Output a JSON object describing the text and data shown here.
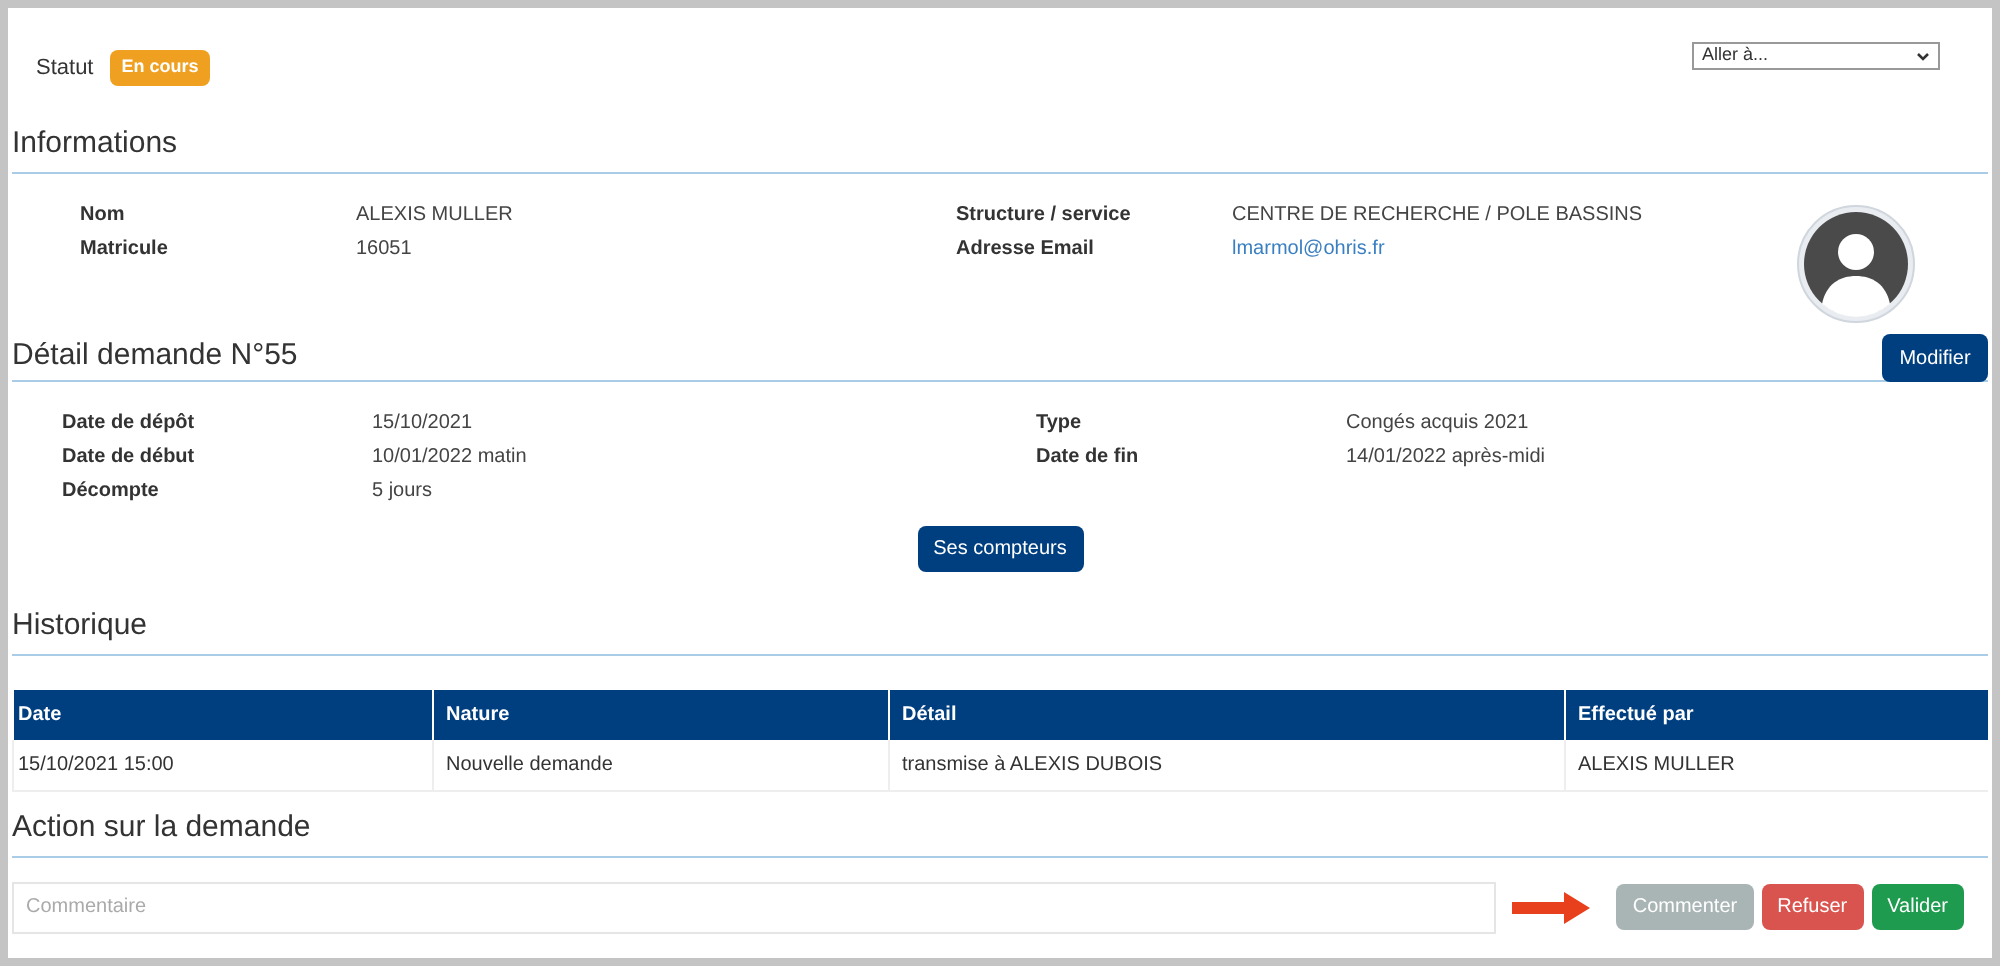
{
  "status": {
    "label": "Statut",
    "badge": "En cours"
  },
  "goto": {
    "value": "Aller à..."
  },
  "informations": {
    "title": "Informations",
    "left": [
      {
        "label": "Nom",
        "value": "ALEXIS MULLER"
      },
      {
        "label": "Matricule",
        "value": "16051"
      }
    ],
    "right": [
      {
        "label": "Structure / service",
        "value": "CENTRE DE RECHERCHE / POLE BASSINS"
      },
      {
        "label": "Adresse Email",
        "value": "lmarmol@ohris.fr",
        "kind": "link"
      }
    ]
  },
  "detail": {
    "title": "Détail demande N°55",
    "button": "Modifier",
    "left": [
      {
        "label": "Date de dépôt",
        "value": "15/10/2021"
      },
      {
        "label": "Date de début",
        "value": "10/01/2022 matin"
      },
      {
        "label": "Décompte",
        "value": "5 jours"
      }
    ],
    "right": [
      {
        "label": "Type",
        "value": "Congés acquis 2021"
      },
      {
        "label": "Date de fin",
        "value": "14/01/2022 après-midi"
      }
    ],
    "counters_button": "Ses compteurs"
  },
  "historique": {
    "title": "Historique",
    "columns": [
      "Date",
      "Nature",
      "Détail",
      "Effectué par"
    ],
    "rows": [
      [
        "15/10/2021 15:00",
        "Nouvelle demande",
        "transmise à ALEXIS DUBOIS",
        "ALEXIS MULLER"
      ]
    ]
  },
  "action": {
    "title": "Action sur la demande",
    "comment": {
      "placeholder": "Commentaire"
    },
    "buttons": [
      {
        "label": "Commenter",
        "color": "#a9b5b5"
      },
      {
        "label": "Refuser",
        "color": "#d9534f"
      },
      {
        "label": "Valider",
        "color": "#1e9b4f"
      }
    ]
  }
}
